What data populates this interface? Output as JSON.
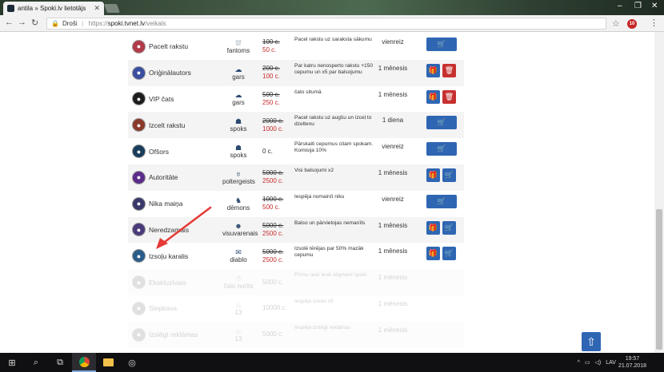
{
  "browser": {
    "tab_title": "antila » Spoki.lv lietotājs",
    "tab_close": "✕",
    "secure_label": "Droši",
    "url_scheme": "https://",
    "url_host": "spoki.tvnet.lv",
    "url_path": "/veikals",
    "extension_badge": "10"
  },
  "items": [
    {
      "name": "Pacelt rakstu",
      "rank": "fantoms",
      "old_price": "100 c.",
      "price": "50 c.",
      "desc": "Pacel rakstu uz saraksta sākumu",
      "duration": "vienreiz",
      "buttons": "buy",
      "icon_color": "#b23a48"
    },
    {
      "name": "Oriģinālautors",
      "rank": "gars",
      "old_price": "200 c.",
      "price": "100 c.",
      "desc": "Par katru nenosperto rakstu +150 cepumu un x5 par balsojumu",
      "duration": "1 mēnesis",
      "buttons": "gift-del",
      "icon_color": "#3b4ea0"
    },
    {
      "name": "VIP čats",
      "rank": "gars",
      "old_price": "500 c.",
      "price": "250 c.",
      "desc": "čato situmā",
      "duration": "1 mēnesis",
      "buttons": "gift-del",
      "icon_color": "#1d1d1d"
    },
    {
      "name": "Izcelt rakstu",
      "rank": "spoks",
      "old_price": "2000 c.",
      "price": "1000 c.",
      "desc": "Pacel rakstu uz augšu un izceļ to dzeltenu",
      "duration": "1 diena",
      "buttons": "buy",
      "icon_color": "#8a3a2a"
    },
    {
      "name": "Ofšors",
      "rank": "spoks",
      "old_price": "",
      "price": "0 c.",
      "desc": "Pārskaiti cepumus citam spokam. Komisija 10%",
      "duration": "vienreiz",
      "buttons": "buy",
      "icon_color": "#1a3d5c"
    },
    {
      "name": "Autoritāte",
      "rank": "poltergeists",
      "old_price": "5000 c.",
      "price": "2500 c.",
      "desc": "Visi balsojumi x2",
      "duration": "1 mēnesis",
      "buttons": "gift-cart",
      "icon_color": "#5a2d8a"
    },
    {
      "name": "Nika maiņa",
      "rank": "dēmons",
      "old_price": "1000 c.",
      "price": "500 c.",
      "desc": "Iespēja nomainīt niku",
      "duration": "vienreiz",
      "buttons": "buy",
      "icon_color": "#3a3a6a"
    },
    {
      "name": "Neredzamais",
      "rank": "visuvarenais",
      "old_price": "5000 c.",
      "price": "2500 c.",
      "desc": "Balso un pārvietojas nemanīts",
      "duration": "1 mēnesis",
      "buttons": "gift-cart",
      "icon_color": "#4a3a7a"
    },
    {
      "name": "Izsoļu karalis",
      "rank": "diablo",
      "old_price": "5000 c.",
      "price": "2500 c.",
      "desc": "Izsolē tērējas par 50% mazāk cepumu",
      "duration": "1 mēnesis",
      "buttons": "gift-cart",
      "icon_color": "#2a5c8a"
    },
    {
      "name": "Ekskluzīvais",
      "rank": "čalo norīts",
      "old_price": "",
      "price": "5000 c.",
      "desc": "Pīrīnu reizi Ievē vēgmenī spoki",
      "duration": "1 mēnesis",
      "buttons": "none",
      "icon_color": "#777777",
      "faded": true
    },
    {
      "name": "Slepkava",
      "rank": "13",
      "old_price": "",
      "price": "10000 c.",
      "desc": "Iespēja izsolu x5",
      "duration": "1 mēnesis",
      "buttons": "none",
      "icon_color": "#777777",
      "faded": true
    },
    {
      "name": "Izslēgt reklāmas",
      "rank": "13",
      "old_price": "",
      "price": "5000 c.",
      "desc": "Iespēja izslēgt reklāmas",
      "duration": "1 mēnesis",
      "buttons": "none",
      "icon_color": "#777777",
      "faded": true
    }
  ],
  "taskbar": {
    "language": "LAV",
    "time": "19:57",
    "date": "21.07.2018"
  }
}
